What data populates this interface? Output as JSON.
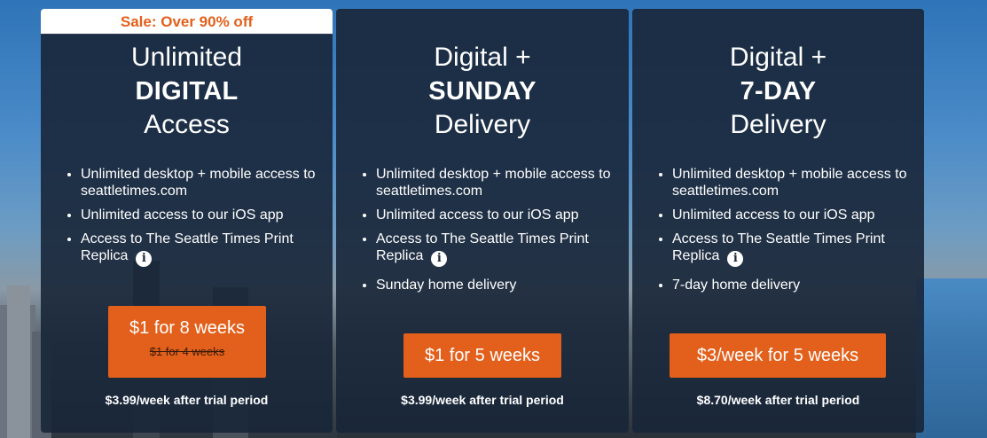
{
  "plans": [
    {
      "sale_banner": "Sale: Over 90% off",
      "title_line1": "Unlimited",
      "title_line2": "DIGITAL",
      "title_line3": "Access",
      "features": [
        "Unlimited desktop + mobile access to seattletimes.com",
        "Unlimited access to our iOS app",
        "Access to The Seattle Times Print Replica"
      ],
      "cta_label": "$1 for 8 weeks",
      "cta_old_price": "$1 for 4 weeks",
      "after_trial": "$3.99/week after trial period"
    },
    {
      "title_line1": "Digital +",
      "title_line2": "SUNDAY",
      "title_line3": "Delivery",
      "features": [
        "Unlimited desktop + mobile access to seattletimes.com",
        "Unlimited access to our iOS app",
        "Access to The Seattle Times Print Replica",
        "Sunday home delivery"
      ],
      "cta_label": "$1 for 5 weeks",
      "after_trial": "$3.99/week after trial period"
    },
    {
      "title_line1": "Digital +",
      "title_line2": "7-DAY",
      "title_line3": "Delivery",
      "features": [
        "Unlimited desktop + mobile access to seattletimes.com",
        "Unlimited access to our iOS app",
        "Access to The Seattle Times Print Replica",
        "7-day home delivery"
      ],
      "cta_label": "$3/week for 5 weeks",
      "after_trial": "$8.70/week after trial period"
    }
  ],
  "icons": {
    "info": "info-icon"
  },
  "colors": {
    "accent": "#e2601b",
    "card_bg": "#182638",
    "banner_bg": "#ffffff"
  }
}
